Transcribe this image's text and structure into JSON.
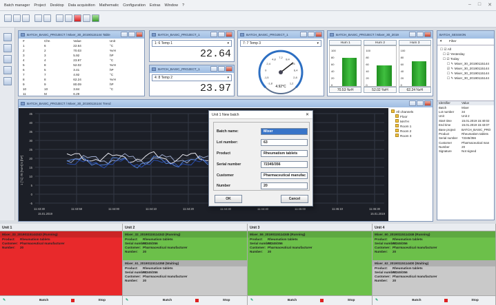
{
  "menu": [
    "Batch manager",
    "Project",
    "Desktop",
    "Data acquisition",
    "Mathematic",
    "Configuration",
    "Extras",
    "Window",
    "?"
  ],
  "window_controls": [
    "–",
    "□",
    "✕"
  ],
  "table_window": {
    "title": "BATCH_BASIC_PROJECT / Mixer_30_20190115144 Table",
    "headers": [
      "#",
      "Chn",
      "Value",
      "Unit"
    ],
    "rows": [
      [
        "1",
        "6",
        "22.64",
        "°C"
      ],
      [
        "2",
        "2",
        "70.03",
        "%rH"
      ],
      [
        "3",
        "3",
        "5.92",
        "hP"
      ],
      [
        "4",
        "4",
        "23.97",
        "°C"
      ],
      [
        "5",
        "8",
        "52.02",
        "%rH"
      ],
      [
        "6",
        "5",
        "3.41",
        "hP"
      ],
      [
        "7",
        "7",
        "4.92",
        "°C"
      ],
      [
        "8",
        "8",
        "62.24",
        "%rH"
      ],
      [
        "9",
        "9",
        "80.09",
        "hP"
      ],
      [
        "10",
        "10",
        "3.84",
        "°C"
      ],
      [
        "11",
        "M",
        "6.29",
        ""
      ]
    ]
  },
  "temp1": {
    "title": "BATCH_BASIC_PROJECT_1",
    "channel": "1: 6 Temp 1",
    "value": "22.64"
  },
  "temp2": {
    "title": "BATCH_BASIC_PROJECT_1",
    "channel": "4: 8 Temp 2",
    "value": "23.97"
  },
  "gauge": {
    "title": "BATCH_BASIC_PROJECT_1",
    "channel": "7: 7 Temp 3",
    "value": "4.92°C",
    "ticks": [
      "-1,8",
      "-1,5",
      "0",
      "2,4",
      "4,8",
      "7,2",
      "8,4",
      "9,6",
      "6,4",
      "2,8",
      "1,2"
    ]
  },
  "humidity": {
    "title": "BATCH_BASIC_PROJECT / Mixer_30_2019",
    "headers": [
      "Hum 1",
      "Hum 2",
      "Hum 3"
    ],
    "axis": [
      "100",
      "80",
      "60",
      "40",
      "20",
      "0"
    ],
    "levels": [
      70.53,
      52.02,
      62.24
    ],
    "values": [
      "70.53 %rH",
      "52.02 %rH",
      "62.24 %rH"
    ]
  },
  "session": {
    "title": "BATCH_SESSION",
    "filter": "Filter",
    "tree": [
      "☐ ☑ All",
      "☐ ☑ Yesterday",
      "☐ ☑ Today",
      "☐ ✎ Mixer_30_20190115144",
      "☑ ✎ Mixer_30_20190115144",
      "☐ ✎ Mixer_30_20190115144",
      "☐ ✎ Mixer_30_20190115144"
    ],
    "prop_headers": [
      "Identifier",
      "Value"
    ],
    "props": [
      [
        "Batch",
        "Mixer"
      ],
      [
        "Lot number",
        "34"
      ],
      [
        "Unit",
        "Unit 2"
      ],
      [
        "Start time",
        "15.01.2019 15:40:02"
      ],
      [
        "End time",
        "15.01.2019 15:43:07"
      ],
      [
        "Base project",
        "BATCH_BASIC_PRO"
      ],
      [
        "Product",
        "Rheumatism tablets"
      ],
      [
        "Serial number",
        "72345/356"
      ],
      [
        "Customer",
        "Pharmaceutical man"
      ],
      [
        "Number",
        "20"
      ],
      [
        "Signature",
        "Not signed"
      ]
    ]
  },
  "trend": {
    "title": "BATCH_BASIC_PROJECT / Mixer_30_20190115144 Trend",
    "y_ticks": [
      "45",
      "40",
      "35",
      "30",
      "25",
      "20",
      "15",
      "10",
      "5",
      "0",
      "-5"
    ],
    "x_ticks": [
      "11:43:30",
      "11:43:58",
      "11:44:00",
      "11:44:10",
      "11:44:20",
      "11:44:30",
      "11:44:40",
      "11:45:00",
      "11:45:10",
      "11:45:30"
    ],
    "x_start": "15.01.2019",
    "x_end": "15.01.2019",
    "yaxis_label": "1 [°C] 70 [%rH] 5 [hP]",
    "legend": [
      "All channels",
      "Floor",
      "MATH",
      "Room 1",
      "Room 2",
      "Room 3"
    ]
  },
  "dialog": {
    "title": "Unit 1 New batch",
    "close": "✕",
    "fields": [
      {
        "label": "Batch name:",
        "value": "Mixer"
      },
      {
        "label": "Lot number:",
        "value": "63"
      },
      {
        "label": "Product",
        "value": "Rheumatism tablets"
      },
      {
        "label": "Serial number",
        "value": "72345/356"
      },
      {
        "label": "Customer",
        "value": "Pharmaceutical manufac"
      },
      {
        "label": "Number",
        "value": "20"
      }
    ],
    "ok": "OK",
    "cancel": "Cancel"
  },
  "units": [
    {
      "name": "Unit 1",
      "color": "#e8292b",
      "jobs": [
        {
          "title": "Mixer_33_20190115144343 (Running)",
          "product": "Rheumatism tablets",
          "serial": "",
          "customer": "Pharmaceutical manufacturer",
          "number": "20"
        }
      ],
      "batch": "Batch",
      "stop": "Stop"
    },
    {
      "name": "Unit 2",
      "color": "#6cc04a",
      "jobs": [
        {
          "title": "Mixer_32_20190115114343 (Running)",
          "product": "Rheumatism tablets",
          "serial": "72345/356",
          "customer": "Pharmaceutical manufacturer",
          "number": "20"
        },
        {
          "title": "Mixer_61_20190115114358 (Waiting)",
          "product": "Rheumatism tablets",
          "serial": "72345/356",
          "customer": "Pharmaceutical manufacturer",
          "number": "20"
        }
      ],
      "batch": "Batch",
      "stop": "Stop"
    },
    {
      "name": "Unit 3",
      "color": "#6cc04a",
      "jobs": [
        {
          "title": "Mixer_59_20190115114345 (Running)",
          "product": "Rheumatism tablets",
          "serial": "72345/356",
          "customer": "Pharmaceutical manufacturer",
          "number": "20"
        }
      ],
      "batch": "Batch",
      "stop": "Stop"
    },
    {
      "name": "Unit 4",
      "color": "#6cc04a",
      "jobs": [
        {
          "title": "Mixer_60_20190115114346 (Running)",
          "product": "Rheumatism tablets",
          "serial": "72345/356",
          "customer": "Pharmaceutical manufacturer",
          "number": "20"
        },
        {
          "title": "Mixer_62_20190115114400 (Waiting)",
          "product": "Rheumatism tablets",
          "serial": "72345/356",
          "customer": "Pharmaceutical manufacturer",
          "number": "20"
        }
      ],
      "batch": "Batch",
      "stop": "Stop"
    }
  ],
  "job_labels": {
    "product": "Product:",
    "serial": "Serial number:",
    "customer": "Customer:",
    "number": "Number:"
  }
}
